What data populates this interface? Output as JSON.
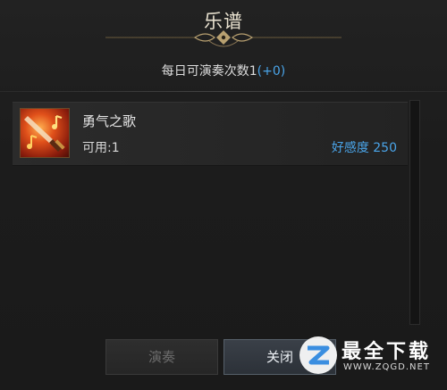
{
  "window": {
    "title": "乐谱",
    "subtitle_prefix": "每日可演奏次数1",
    "subtitle_bonus": "(+0)"
  },
  "songs": [
    {
      "name": "勇气之歌",
      "available": "可用:1",
      "favor": "好感度 250",
      "icon": "sword-music-icon"
    }
  ],
  "buttons": {
    "play_label": "演奏",
    "close_label": "关闭"
  },
  "watermark": {
    "text": "最全下载",
    "url": "WWW.ZQGD.NET"
  },
  "colors": {
    "accent_blue": "#4aa4e8",
    "title_text": "#e8e1cf",
    "ornament_gold": "#b8a070",
    "disabled_text": "#6c6c6c"
  }
}
